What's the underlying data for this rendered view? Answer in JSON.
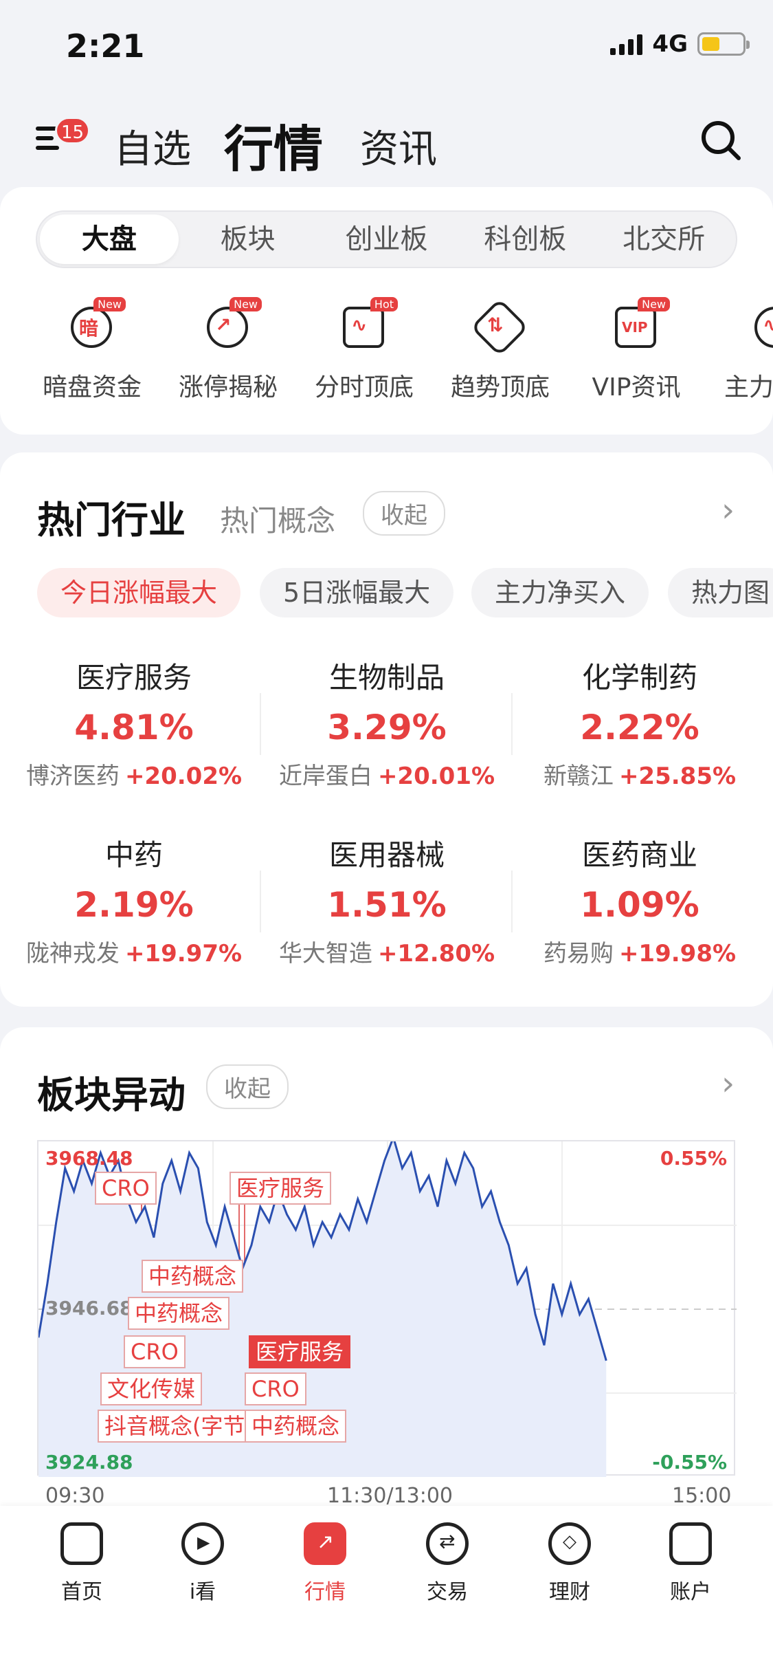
{
  "status": {
    "time": "2:21",
    "network": "4G"
  },
  "header": {
    "badge": "15",
    "tabs": [
      "自选",
      "行情",
      "资讯"
    ]
  },
  "segments": [
    "大盘",
    "板块",
    "创业板",
    "科创板",
    "北交所"
  ],
  "quick_icons": [
    {
      "label": "暗盘资金",
      "glyph": "暗",
      "tag": "New"
    },
    {
      "label": "涨停揭秘",
      "glyph": "↗",
      "tag": "New"
    },
    {
      "label": "分时顶底",
      "glyph": "∿",
      "tag": "Hot"
    },
    {
      "label": "趋势顶底",
      "glyph": "⇅",
      "tag": ""
    },
    {
      "label": "VIP资讯",
      "glyph": "VIP",
      "tag": "New"
    },
    {
      "label": "主力",
      "glyph": "∿",
      "tag": ""
    }
  ],
  "hot": {
    "title": "热门行业",
    "alt": "热门概念",
    "collapse": "收起",
    "chips": [
      "今日涨幅最大",
      "5日涨幅最大",
      "主力净买入",
      "热力图"
    ],
    "items": [
      {
        "name": "医疗服务",
        "pct": "4.81%",
        "stock": "博济医药",
        "stock_pct": "+20.02%"
      },
      {
        "name": "生物制品",
        "pct": "3.29%",
        "stock": "近岸蛋白",
        "stock_pct": "+20.01%"
      },
      {
        "name": "化学制药",
        "pct": "2.22%",
        "stock": "新赣江",
        "stock_pct": "+25.85%"
      },
      {
        "name": "中药",
        "pct": "2.19%",
        "stock": "陇神戎发",
        "stock_pct": "+19.97%"
      },
      {
        "name": "医用器械",
        "pct": "1.51%",
        "stock": "华大智造",
        "stock_pct": "+12.80%"
      },
      {
        "name": "医药商业",
        "pct": "1.09%",
        "stock": "药易购",
        "stock_pct": "+19.98%"
      }
    ]
  },
  "movers": {
    "title": "板块异动",
    "collapse": "收起",
    "tags": [
      "CRO",
      "医疗服务",
      "中药概念",
      "中药概念",
      "CRO",
      "医疗服务",
      "文化传媒",
      "CRO",
      "抖音概念(字节",
      "中药概念"
    ],
    "chart_data": {
      "type": "line",
      "y_high": "3968.48",
      "y_mid": "3946.68",
      "y_low": "3924.88",
      "pct_high": "0.55%",
      "pct_low": "-0.55%",
      "x_labels": [
        "09:30",
        "11:30/13:00",
        "15:00"
      ],
      "ylim": [
        3924.88,
        3968.48
      ],
      "series": [
        {
          "values": [
            3943,
            3950,
            3958,
            3965,
            3962,
            3966,
            3963,
            3967,
            3964,
            3966,
            3961,
            3958,
            3960,
            3956,
            3963,
            3966,
            3962,
            3967,
            3965,
            3958,
            3955,
            3960,
            3956,
            3952,
            3955,
            3960,
            3958,
            3962,
            3959,
            3957,
            3960,
            3955,
            3958,
            3956,
            3959,
            3957,
            3961,
            3958,
            3962,
            3966,
            3969,
            3965,
            3967,
            3962,
            3964,
            3960,
            3966,
            3963,
            3967,
            3965,
            3960,
            3962,
            3958,
            3955,
            3950,
            3952,
            3946,
            3942,
            3950,
            3946,
            3950,
            3946,
            3948,
            3944,
            3940
          ]
        }
      ]
    }
  },
  "tabbar": [
    "首页",
    "i看",
    "行情",
    "交易",
    "理财",
    "账户"
  ]
}
